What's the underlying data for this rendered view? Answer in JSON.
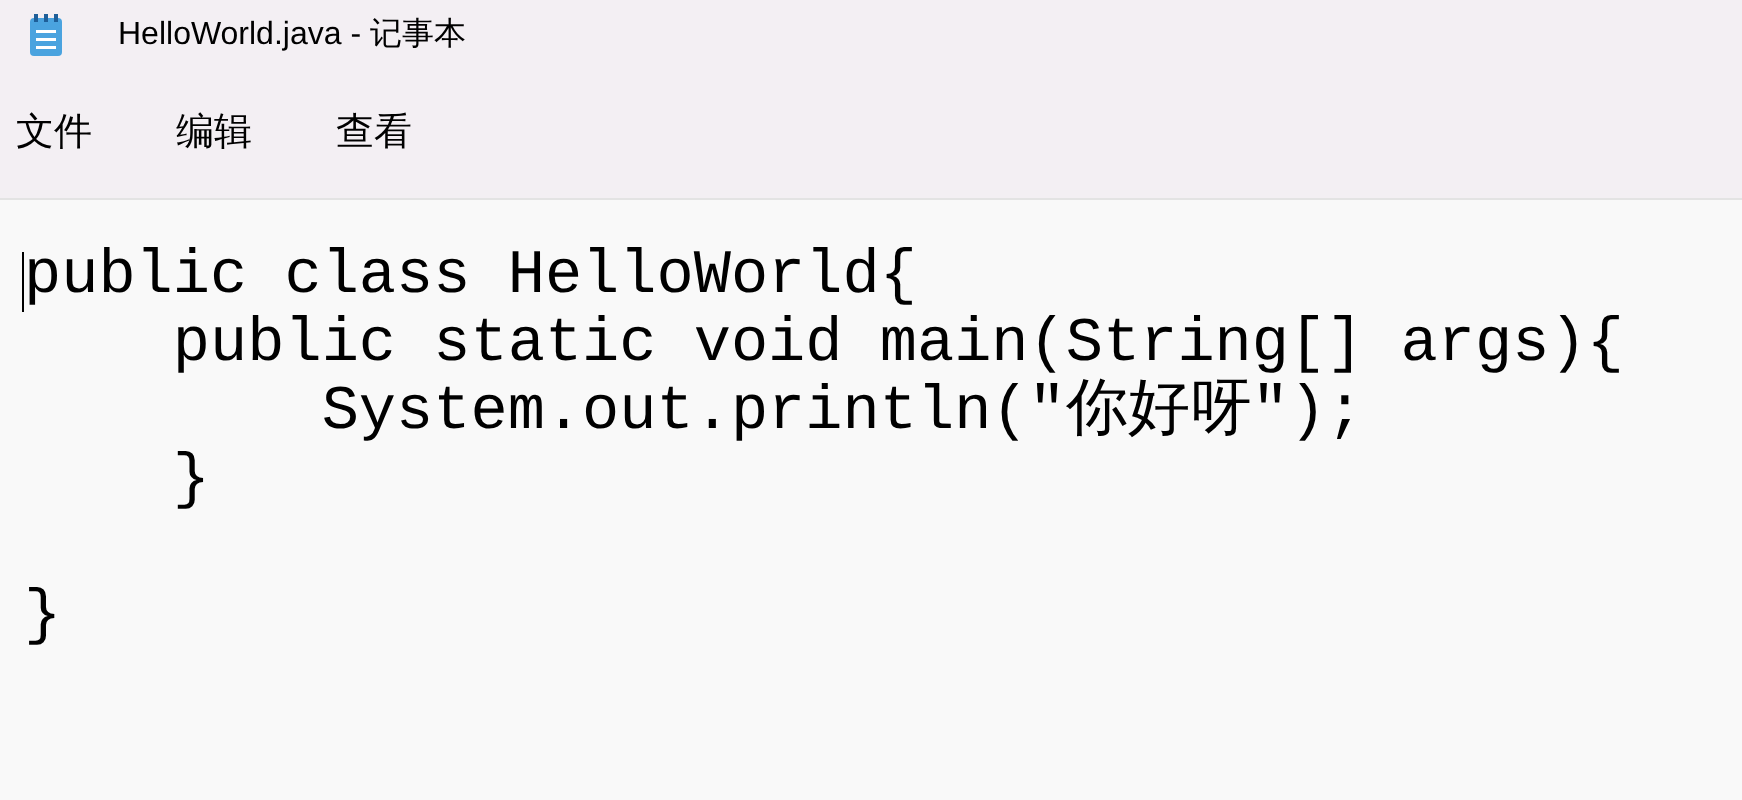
{
  "window": {
    "title": "HelloWorld.java - 记事本"
  },
  "menu": [
    "文件",
    "编辑",
    "查看"
  ],
  "editor": {
    "lines": [
      {
        "kind": "code",
        "text": "public class HelloWorld{"
      },
      {
        "kind": "code",
        "text": "    public static void main(String[] args){"
      },
      {
        "kind": "code",
        "text": "        System.out.println(\"你好呀\");"
      },
      {
        "kind": "code",
        "text": "    }"
      },
      {
        "kind": "blank"
      },
      {
        "kind": "code",
        "text": "}"
      }
    ]
  }
}
